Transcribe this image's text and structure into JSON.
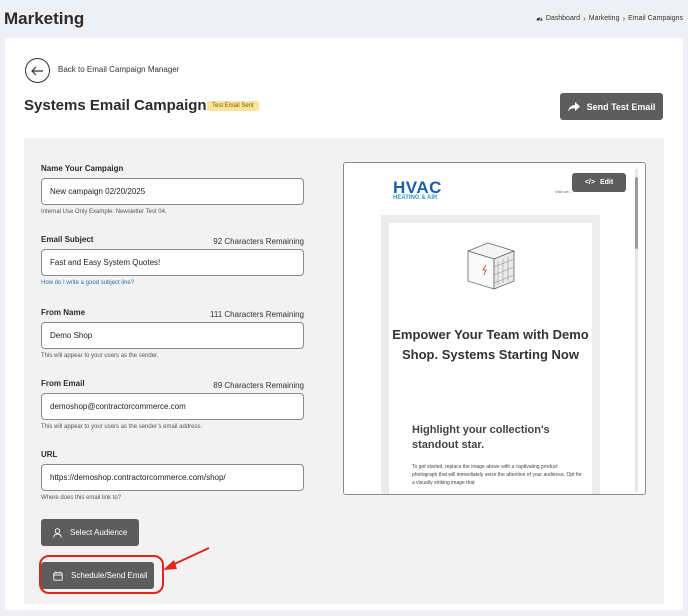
{
  "header": {
    "title": "Marketing",
    "breadcrumb": [
      "Dashboard",
      "Marketing",
      "Email Campaigns"
    ]
  },
  "top": {
    "back_label": "Back to Email Campaign Manager",
    "campaign_title": "Systems Email Campaign",
    "badge": "Test Email Sent",
    "send_test_label": "Send Test Email"
  },
  "form": {
    "name": {
      "label": "Name Your Campaign",
      "value": "New campaign 02/20/2025",
      "helper": "Internal Use Only Example: Newsletter Test 04."
    },
    "subject": {
      "label": "Email Subject",
      "chars": "92 Characters Remaining",
      "value": "Fast and Easy System Quotes!",
      "link": "How do I write a good subject line?"
    },
    "from_name": {
      "label": "From Name",
      "chars": "111 Characters Remaining",
      "value": "Demo Shop",
      "helper": "This will appear to your users as the sender."
    },
    "from_email": {
      "label": "From Email",
      "chars": "89 Characters Remaining",
      "value": "demoshop@contractorcommerce.com",
      "helper": "This will appear to your users as the sender’s email address."
    },
    "url": {
      "label": "URL",
      "value": "https://demoshop.contractorcommerce.com/shop/",
      "helper": "Where does this email link to?"
    },
    "select_audience_label": "Select Audience",
    "schedule_label": "Schedule/Send Email"
  },
  "preview": {
    "logo_text": "HVAC",
    "logo_subtext": "HEATING & AIR",
    "visit_link": "Visit we...",
    "edit_label": "Edit",
    "hero_title": "Empower Your Team with Demo Shop. Systems Starting Now",
    "subtitle": "Highlight your collection's standout star.",
    "body_text": "To get started, replace the image above with a captivating product photograph that will immediately seize the attention of your audience. Opt for a visually striking image that"
  },
  "colors": {
    "button_dark": "#5d5d5d",
    "badge_bg": "#fbe39a",
    "annotation_red": "#e0251b",
    "logo_blue": "#1b5fa6"
  }
}
